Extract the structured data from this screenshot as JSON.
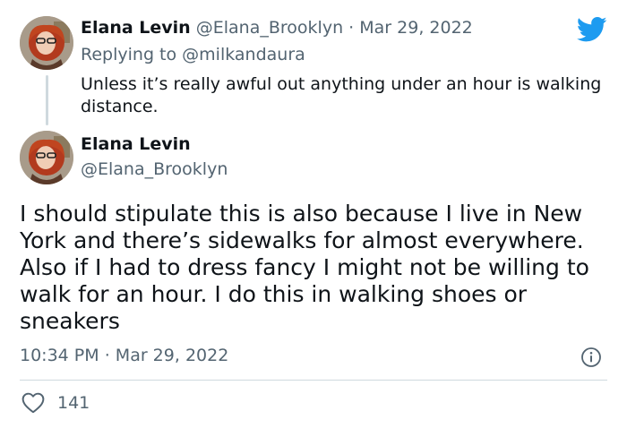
{
  "reply_tweet": {
    "author_name": "Elana Levin",
    "author_handle": "@Elana_Brooklyn",
    "separator": "·",
    "date": "Mar 29, 2022",
    "replying_prefix": "Replying to",
    "replying_handle": "@milkandaura",
    "text": "Unless it’s really awful out anything under an hour is walking distance."
  },
  "main_tweet": {
    "author_name": "Elana Levin",
    "author_handle": "@Elana_Brooklyn",
    "text": "I should stipulate this is also because I live in New York and there’s sidewalks for almost everywhere. Also if I had to dress fancy I might not be willing to walk for an hour. I do this in walking shoes or sneakers",
    "time": "10:34 PM",
    "separator": "·",
    "date": "Mar 29, 2022",
    "like_count": "141"
  },
  "icons": {
    "brand": "twitter-bird-icon",
    "info": "info-icon",
    "like": "heart-icon"
  },
  "colors": {
    "brand_blue": "#1d9bf0",
    "text_primary": "#0f1419",
    "text_secondary": "#536471",
    "divider": "#cfd9de"
  }
}
